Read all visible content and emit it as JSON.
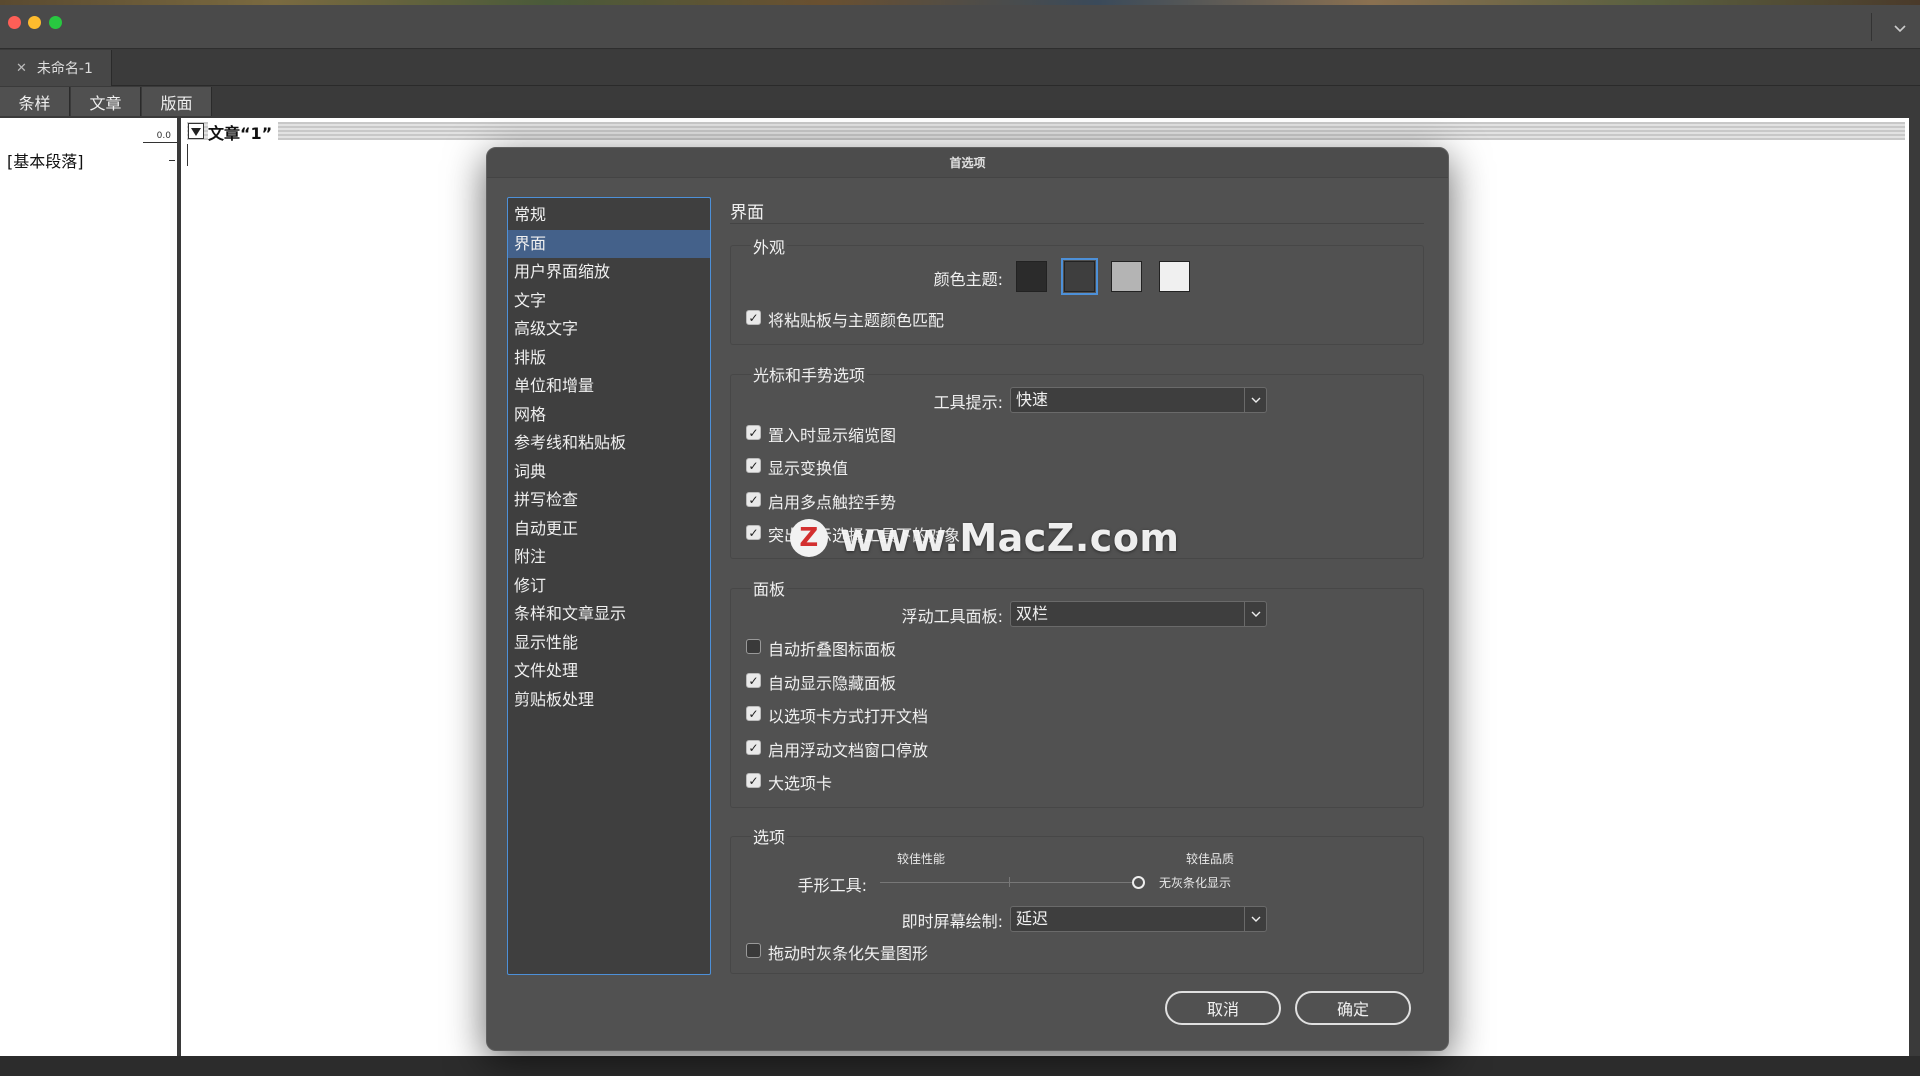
{
  "window": {
    "document_tab": "未命名-1"
  },
  "view_tabs": [
    "条样",
    "文章",
    "版面"
  ],
  "left_pane": {
    "ruler_value": "0.0",
    "paragraph_style": "[基本段落]"
  },
  "story": {
    "title": "文章“1”"
  },
  "dialog": {
    "title": "首选项",
    "categories": [
      "常规",
      "界面",
      "用户界面缩放",
      "文字",
      "高级文字",
      "排版",
      "单位和增量",
      "网格",
      "参考线和粘贴板",
      "词典",
      "拼写检查",
      "自动更正",
      "附注",
      "修订",
      "条样和文章显示",
      "显示性能",
      "文件处理",
      "剪贴板处理"
    ],
    "selected_category": "界面",
    "section_title": "界面",
    "appearance": {
      "title": "外观",
      "color_theme_label": "颜色主题:",
      "themes": [
        {
          "name": "darkest",
          "color": "#2b2b2b"
        },
        {
          "name": "dark",
          "color": "#3e3e3e"
        },
        {
          "name": "medium-light",
          "color": "#b4b4b4"
        },
        {
          "name": "light",
          "color": "#f0f0f0"
        }
      ],
      "match_pasteboard": "将粘贴板与主题颜色匹配"
    },
    "cursor_gestures": {
      "title": "光标和手势选项",
      "tooltip_label": "工具提示:",
      "tooltip_value": "快速",
      "checkboxes": [
        {
          "label": "置入时显示缩览图",
          "checked": true
        },
        {
          "label": "显示变换值",
          "checked": true
        },
        {
          "label": "启用多点触控手势",
          "checked": true
        },
        {
          "label": "突出显示选择工具下的对象",
          "checked": true
        }
      ]
    },
    "panels": {
      "title": "面板",
      "floating_tools_label": "浮动工具面板:",
      "floating_tools_value": "双栏",
      "checkboxes": [
        {
          "label": "自动折叠图标面板",
          "checked": false
        },
        {
          "label": "自动显示隐藏面板",
          "checked": true
        },
        {
          "label": "以选项卡方式打开文档",
          "checked": true
        },
        {
          "label": "启用浮动文档窗口停放",
          "checked": true
        },
        {
          "label": "大选项卡",
          "checked": true
        }
      ]
    },
    "options": {
      "title": "选项",
      "hand_tool_label": "手形工具:",
      "better_performance": "较佳性能",
      "better_quality": "较佳品质",
      "no_greeking": "无灰条化显示",
      "live_draw_label": "即时屏幕绘制:",
      "live_draw_value": "延迟",
      "greek_vector": "拖动时灰条化矢量图形",
      "greek_vector_checked": false
    },
    "cancel": "取消",
    "ok": "确定"
  },
  "watermark": {
    "logo_letter": "Z",
    "text": "www.MacZ.com"
  },
  "colors": {
    "accent": "#4d90d8",
    "selection": "#44618a",
    "dialog_bg": "#515151"
  }
}
